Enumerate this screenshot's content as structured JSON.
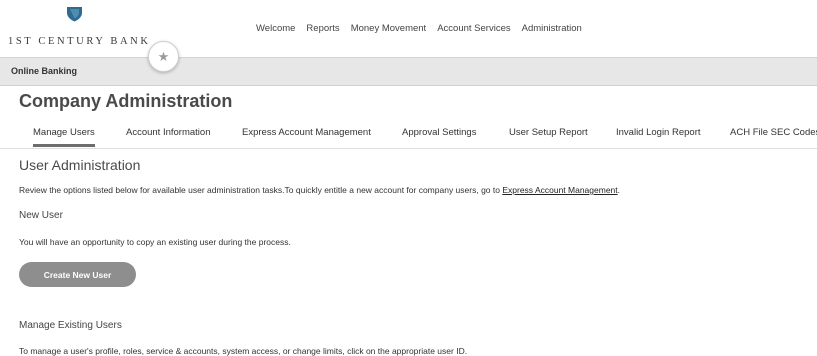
{
  "header": {
    "bank_name": "1st Century Bank",
    "logo_icon": "shield-icon",
    "favorite_icon": "star-icon",
    "nav": [
      "Welcome",
      "Reports",
      "Money Movement",
      "Account Services",
      "Administration"
    ]
  },
  "breadcrumb": "Online Banking",
  "page_title": "Company Administration",
  "tabs": [
    "Manage Users",
    "Account Information",
    "Express Account Management",
    "Approval Settings",
    "User Setup Report",
    "Invalid Login Report",
    "ACH File SEC Codes"
  ],
  "active_tab": "Manage Users",
  "section": {
    "title": "User Administration",
    "intro": "Review the options listed below for available user administration tasks.To quickly entitle a new account for company users, go to",
    "intro_link": "Express Account Management",
    "intro_end": "."
  },
  "new_user": {
    "heading": "New User",
    "description": "You will have an opportunity to copy an existing user during the process.",
    "button": "Create New User"
  },
  "manage_existing": {
    "heading": "Manage Existing Users",
    "description": "To manage a user's profile, roles, service & accounts, system access, or change limits, click on the appropriate user ID."
  },
  "colors": {
    "accent": "#2f6b8f",
    "button": "#8e8e8e",
    "graybar": "#e7e7e7"
  }
}
